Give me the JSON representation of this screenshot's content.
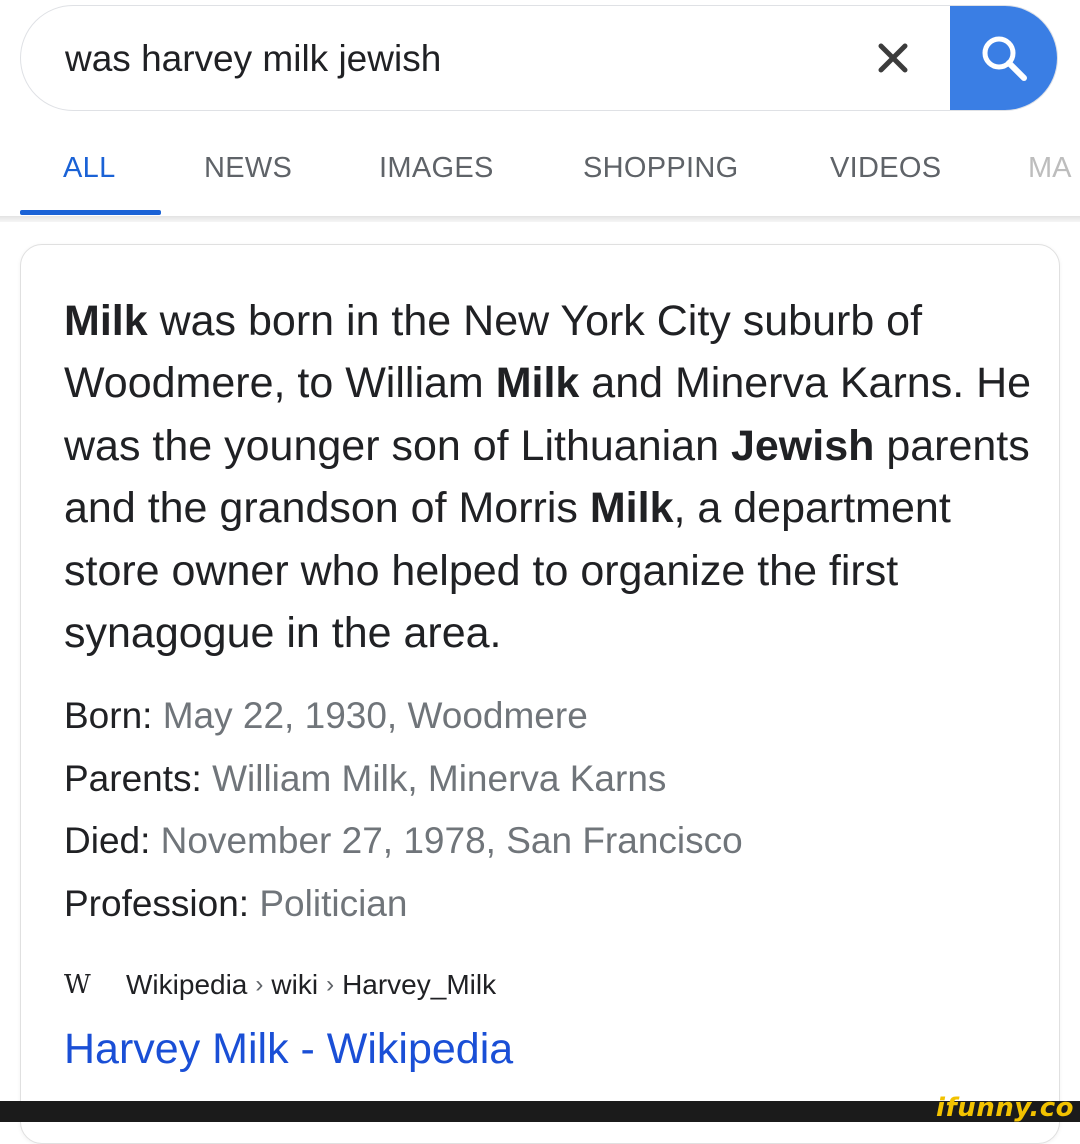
{
  "search": {
    "query": "was harvey milk jewish",
    "clear_icon": "close-icon",
    "search_icon": "magnifier-icon"
  },
  "tabs": [
    {
      "label": "ALL",
      "active": true
    },
    {
      "label": "NEWS",
      "active": false
    },
    {
      "label": "IMAGES",
      "active": false
    },
    {
      "label": "SHOPPING",
      "active": false
    },
    {
      "label": "VIDEOS",
      "active": false
    },
    {
      "label": "MA",
      "active": false
    }
  ],
  "snippet": {
    "parts": [
      {
        "text": "Milk",
        "bold": true
      },
      {
        "text": " was born in the New York City suburb of Woodmere, to William ",
        "bold": false
      },
      {
        "text": "Milk",
        "bold": true
      },
      {
        "text": " and Minerva Karns. He was the younger son of Lithuanian ",
        "bold": false
      },
      {
        "text": "Jewish",
        "bold": true
      },
      {
        "text": " parents and the grandson of Morris ",
        "bold": false
      },
      {
        "text": "Milk",
        "bold": true
      },
      {
        "text": ", a department store owner who helped to organize the first synagogue in the area.",
        "bold": false
      }
    ]
  },
  "facts": {
    "born": {
      "label": "Born:",
      "value": "May 22, 1930, Woodmere"
    },
    "parents": {
      "label": "Parents:",
      "value": "William Milk, Minerva Karns"
    },
    "died": {
      "label": "Died:",
      "value": "November 27, 1978, San Francisco"
    },
    "profession": {
      "label": "Profession:",
      "value": "Politician"
    }
  },
  "source": {
    "icon_text": "W",
    "crumbs": [
      "Wikipedia",
      "wiki",
      "Harvey_Milk"
    ],
    "separator": "›"
  },
  "result": {
    "title": "Harvey Milk - Wikipedia"
  },
  "watermark": "ifunny.co",
  "colors": {
    "accent_blue": "#1a62d6",
    "search_button": "#3a7ee4",
    "link": "#1a4fd6",
    "muted": "#70757a"
  }
}
